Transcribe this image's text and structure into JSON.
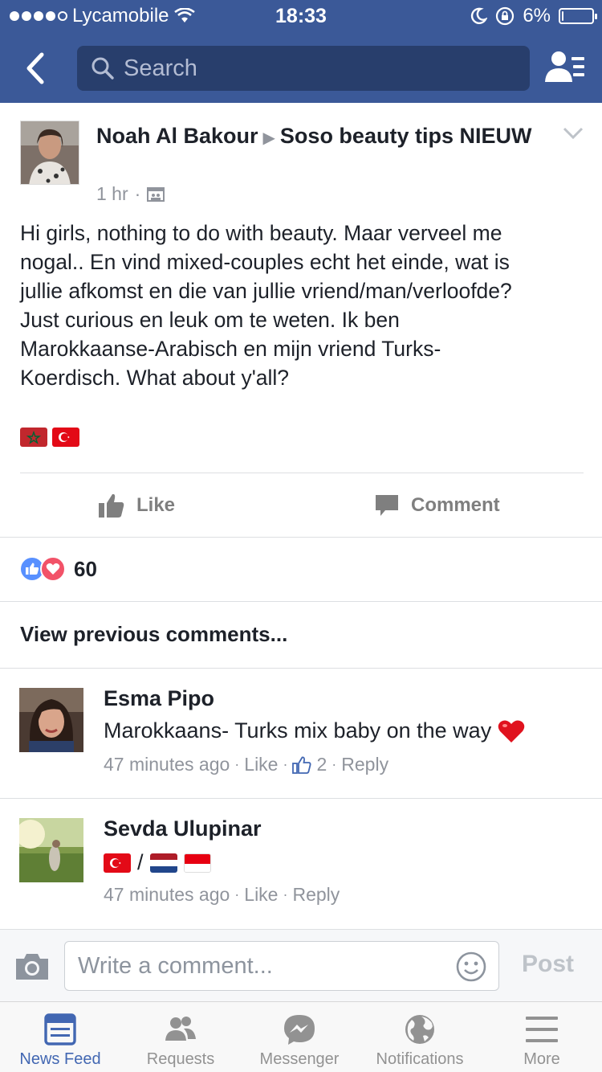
{
  "status_bar": {
    "carrier": "Lycamobile",
    "time": "18:33",
    "battery": "6%",
    "battery_level": 0.06
  },
  "nav": {
    "search_placeholder": "Search"
  },
  "post": {
    "author": "Noah Al Bakour",
    "group": "Soso beauty tips NIEUW",
    "time": "1 hr",
    "text": "Hi girls, nothing to do with beauty. Maar verveel me\nnogal.. En vind mixed-couples echt het einde, wat is\njullie afkomst en die van jullie vriend/man/verloofde?\nJust curious en leuk om te weten. Ik ben\nMarokkaanse-Arabisch en mijn vriend Turks-\nKoerdisch. What about y'all?",
    "like_label": "Like",
    "comment_label": "Comment",
    "reaction_count": "60",
    "view_previous": "View previous comments..."
  },
  "comments": [
    {
      "author": "Esma Pipo",
      "text": "Marokkaans- Turks mix baby on the way",
      "time": "47 minutes ago",
      "like": "Like",
      "likes": "2",
      "reply": "Reply"
    },
    {
      "author": "Sevda Ulupinar",
      "text_sep": "/",
      "time": "47 minutes ago",
      "like": "Like",
      "reply": "Reply"
    }
  ],
  "compose": {
    "placeholder": "Write a comment...",
    "post_label": "Post"
  },
  "tabs": [
    {
      "label": "News Feed",
      "icon": "news-feed-icon",
      "active": true
    },
    {
      "label": "Requests",
      "icon": "requests-icon"
    },
    {
      "label": "Messenger",
      "icon": "messenger-icon"
    },
    {
      "label": "Notifications",
      "icon": "globe-icon"
    },
    {
      "label": "More",
      "icon": "menu-icon"
    }
  ],
  "colors": {
    "brand": "#3b5998",
    "active_tab": "#4267b2",
    "muted": "#90949c"
  }
}
